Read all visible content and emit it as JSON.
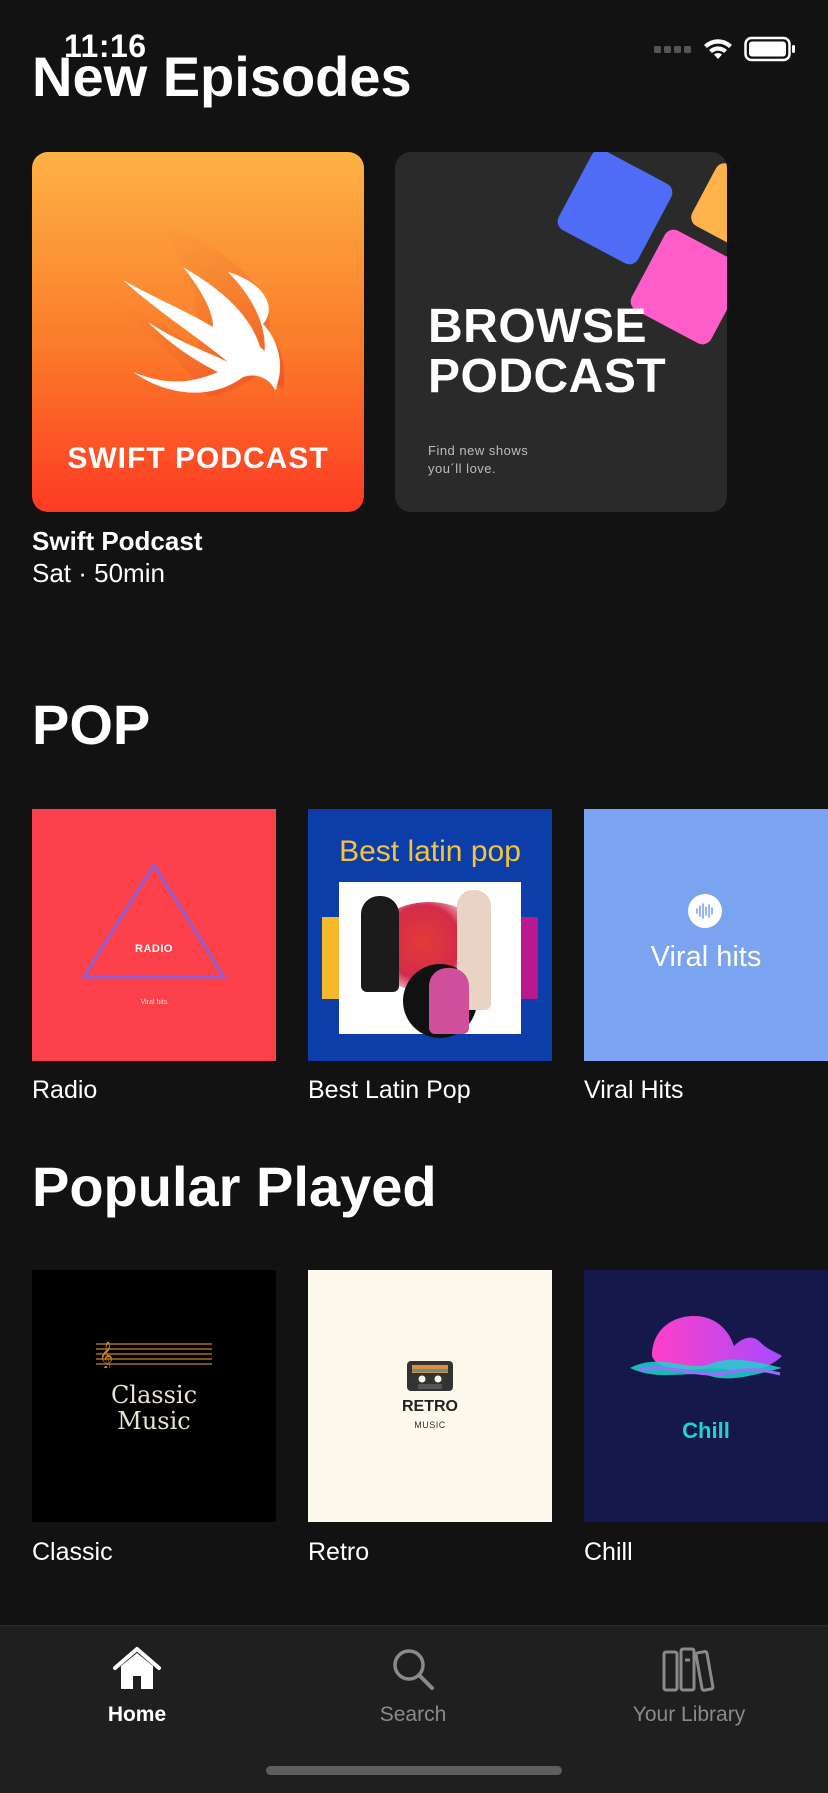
{
  "status_bar": {
    "time": "11:16"
  },
  "sections": {
    "new_episodes": "New Episodes",
    "pop": "POP",
    "popular_played": "Popular Played"
  },
  "episodes": {
    "swift": {
      "art_text": "SWIFT PODCAST",
      "name": "Swift Podcast",
      "meta": "Sat · 50min"
    },
    "browse": {
      "title_line1": "BROWSE",
      "title_line2": "PODCAST",
      "subtitle_line1": "Find new shows",
      "subtitle_line2": "you´ll love."
    }
  },
  "pop": [
    {
      "label": "Radio",
      "art_title": "RADIO",
      "art_sub": "Viral hits",
      "color": "#fc4049"
    },
    {
      "label": "Best Latin Pop",
      "art_title": "Best latin pop",
      "color": "#0b3ea8"
    },
    {
      "label": "Viral Hits",
      "art_title": "Viral hits",
      "color": "#7aa3f0"
    }
  ],
  "popular": [
    {
      "label": "Classic",
      "art_title_line1": "Classic",
      "art_title_line2": "Music",
      "color": "#000000"
    },
    {
      "label": "Retro",
      "art_title": "RETRO",
      "art_sub": "MUSIC",
      "color": "#fdf9ec"
    },
    {
      "label": "Chill",
      "art_title": "Chill",
      "color": "#15184a"
    }
  ],
  "tabbar": {
    "home": "Home",
    "search": "Search",
    "library": "Your Library",
    "active_color": "#ffffff",
    "inactive_color": "#8a8a8a"
  }
}
